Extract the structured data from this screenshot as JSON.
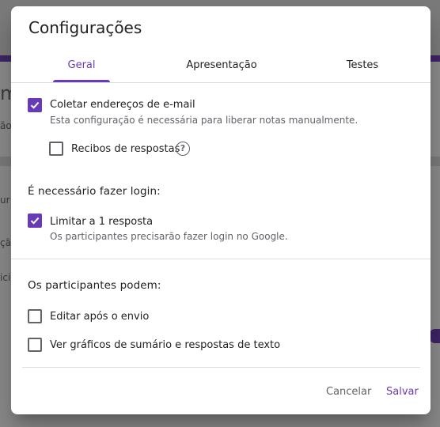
{
  "background": {
    "fragments": [
      "m",
      "ão",
      "ur",
      "çã",
      "ici"
    ]
  },
  "dialog": {
    "title": "Configurações",
    "tabs": [
      {
        "label": "Geral",
        "active": true
      },
      {
        "label": "Apresentação",
        "active": false
      },
      {
        "label": "Testes",
        "active": false
      }
    ],
    "general": {
      "collect_emails": {
        "label": "Coletar endereços de e-mail",
        "hint": "Esta configuração é necessária para liberar notas manualmente.",
        "checked": true
      },
      "response_receipts": {
        "label": "Recibos de respostas",
        "checked": false,
        "help_icon": "help-circle-icon"
      },
      "login_section": {
        "title": "É necessário fazer login:"
      },
      "limit_one_response": {
        "label": "Limitar a 1 resposta",
        "hint": "Os participantes precisarão fazer login no Google.",
        "checked": true
      },
      "participants_section": {
        "title": "Os participantes podem:"
      },
      "edit_after_submit": {
        "label": "Editar após o envio",
        "checked": false
      },
      "see_summary": {
        "label": "Ver gráficos de sumário e respostas de texto",
        "checked": false
      }
    },
    "actions": {
      "cancel": "Cancelar",
      "save": "Salvar"
    }
  },
  "colors": {
    "accent": "#673ab7",
    "text": "#202124",
    "secondary_text": "#5f6368",
    "divider": "#dadce0"
  }
}
